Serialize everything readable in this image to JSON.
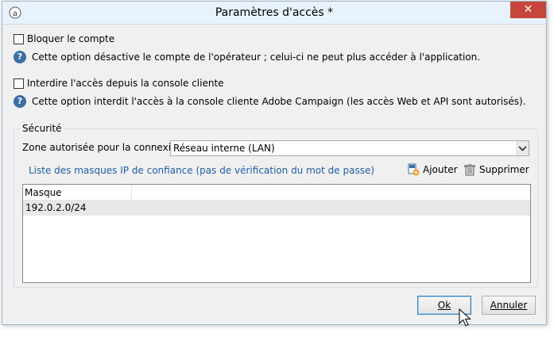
{
  "window": {
    "title": "Paramètres d'accès *",
    "close_label": "✕"
  },
  "options": [
    {
      "label": "Bloquer le compte",
      "checked": false,
      "help": "Cette option désactive le compte de l'opérateur ; celui-ci ne peut plus accéder à l'application."
    },
    {
      "label": "Interdire l'accès depuis la console cliente",
      "checked": false,
      "help": "Cette option interdit l'accès à la console cliente Adobe Campaign (les accès Web et API sont autorisés)."
    }
  ],
  "security": {
    "legend": "Sécurité",
    "zone_label": "Zone autorisée pour la connexion :",
    "zone_value": "Réseau interne (LAN)",
    "masks_link": "Liste des masques IP de confiance (pas de vérification du mot de passe)",
    "add_label": "Ajouter",
    "delete_label": "Supprimer",
    "table": {
      "columns": [
        "Masque"
      ],
      "rows": [
        [
          "192.0.2.0/24"
        ]
      ]
    }
  },
  "buttons": {
    "ok": "Ok",
    "cancel": "Annuler"
  },
  "colors": {
    "link": "#1f5ea8",
    "close": "#c7463c",
    "help_icon": "#3a6ea5"
  }
}
